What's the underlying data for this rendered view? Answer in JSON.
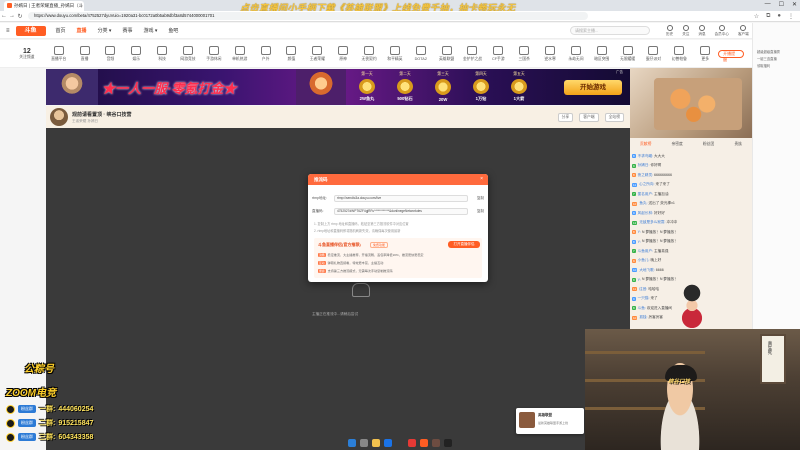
{
  "browser": {
    "tab_title": "孙嫣日 | 王者荣耀直播_孙嫣日（斗",
    "banner_text": "点击直播间小手柄下载《英雄联盟》上线免费千抽，抽卡畅玩永无",
    "url": "https://www.douyu.com/beta/4752527dyuVuio=1920a31-bc0172a0b5ab9dbf3a8d5744000001701"
  },
  "site": {
    "logo": "斗鱼",
    "nav": [
      {
        "label": "首页"
      },
      {
        "label": "直播"
      },
      {
        "label": "分类 ▾"
      },
      {
        "label": "赛事"
      },
      {
        "label": "游戏 ▾"
      },
      {
        "label": "鱼吧"
      }
    ],
    "search_placeholder": "请搜索主播...",
    "header_icons": [
      {
        "label": "历史",
        "icon": "history-icon"
      },
      {
        "label": "关注",
        "icon": "follow-icon"
      },
      {
        "label": "消息",
        "icon": "message-icon"
      },
      {
        "label": "会员中心",
        "icon": "member-icon"
      },
      {
        "label": "客户端",
        "icon": "client-icon"
      }
    ]
  },
  "categories": {
    "count": "12",
    "count_label": "关注频道",
    "items": [
      "直播平台",
      "直播",
      "音频",
      "娱乐",
      "科技",
      "网游竞技",
      "手游休闲",
      "单机热游",
      "户外",
      "颜值",
      "王者荣耀",
      "原神",
      "无畏契约",
      "和平精英",
      "DOTA2",
      "英雄联盟",
      "金铲铲之战",
      "CF手游",
      "三国杀",
      "逆水寒",
      "永劫无间",
      "暗区突围",
      "无限暖暖",
      "蛋仔派对",
      "幻兽帕鲁",
      "更多"
    ],
    "fav_button": "开播提醒"
  },
  "ad": {
    "title": "★一人一服·零氪打金★",
    "coins": [
      {
        "top": "第一天",
        "value": "2W鱼丸"
      },
      {
        "top": "第二天",
        "value": "500钻石"
      },
      {
        "top": "第三天",
        "value": "20W"
      },
      {
        "top": "第四天",
        "value": "1万钻"
      },
      {
        "top": "第五天",
        "value": "1大箭"
      }
    ],
    "button": "开始游戏",
    "mark": "广告"
  },
  "room": {
    "title": "观前请看置顶 · 峡谷口技营",
    "subtitle": "王者荣耀  孙嫣日",
    "actions": [
      "分享",
      "客户端",
      "全站榜"
    ]
  },
  "modal": {
    "title": "推流码",
    "close": "×",
    "rtmp_label": "rtmp地址:",
    "rtmp_value": "rtmp://sendtc3a.douyu.com/live",
    "key_label": "直播码:",
    "key_value": "4752527dWPT6ZF4gjRFu************&dunlinegeNetworkdes",
    "copy": "复制",
    "notes": [
      "1. 复制上方 rtmp 地址和直播码，粘贴至第三方推流软件中对应位置",
      "2. rtmp地址和直播码即将随机刷新失效，请确保每次使用最新"
    ],
    "promo": {
      "title": "斗鱼直播伴侣(官方推荐)",
      "badge": "免费功能",
      "button": "打开直播伴侣",
      "lines": [
        {
          "tag": "流畅",
          "text": "稳定推流，大主播推荐，开播流畅，丢包率降低20%，推流更快更稳定"
        },
        {
          "tag": "互动",
          "text": "弹幕礼物直接看，特效更丰富，主播互动"
        },
        {
          "tag": "便捷",
          "text": "支持第三方推流模式，无需每次手动复制推流码"
        }
      ]
    },
    "hint": "主播正在推流中...请稍后尝试"
  },
  "chat": {
    "tabs": [
      "贡献榜",
      "亲密度",
      "粉丝团",
      "贵族"
    ],
    "messages": [
      {
        "badge": "8",
        "user": "不求鸟瞰:",
        "text": "大大大"
      },
      {
        "badge": "9",
        "user": "孙嫣日:",
        "text": "你好啊"
      },
      {
        "badge": "8",
        "user": "夜之精灵:",
        "text": "666666666"
      },
      {
        "badge": "11",
        "user": "心之所向:",
        "text": "来了来了"
      },
      {
        "badge": "7",
        "user": "匿名用户:",
        "text": "主播加油"
      },
      {
        "badge": "10",
        "user": "鱼丸:",
        "text": "送出了 荧光棒x1"
      },
      {
        "badge": "9",
        "user": "风起长林:",
        "text": "好好好"
      },
      {
        "badge": "12",
        "user": "无敌是多么寂寞:",
        "text": "冲冲冲"
      },
      {
        "badge": "8",
        "user": "Y:",
        "text": "N 萝播放！N 萝播放！"
      },
      {
        "badge": "8",
        "user": "Y:",
        "text": "N 萝播放！N 萝播放！"
      },
      {
        "badge": "7",
        "user": "斗鱼用户:",
        "text": "主播真强"
      },
      {
        "badge": "9",
        "user": "小鱼儿:",
        "text": "晚上好"
      },
      {
        "badge": "10",
        "user": "大地飞歌:",
        "text": "6666"
      },
      {
        "badge": "8",
        "user": "Y:",
        "text": "N 萝播放！N 萝播放！"
      },
      {
        "badge": "11",
        "user": "往昔:",
        "text": "哈哈哈"
      },
      {
        "badge": "9",
        "user": "一只猫:",
        "text": "来了"
      },
      {
        "badge": "8",
        "user": "斗鱼:",
        "text": "欢迎进入直播间"
      },
      {
        "badge": "10",
        "user": "孤独:",
        "text": "厉害厉害"
      }
    ]
  },
  "far_strip": [
    "超级超级直播秀",
    "一键三连直播",
    "领取福利"
  ],
  "overlay": {
    "line1": "公粽号",
    "line2": "ZOOM电竞",
    "qq": [
      {
        "tag": "粉丝群",
        "label": "一群:",
        "num": "444060254"
      },
      {
        "tag": "粉丝群",
        "label": "二群:",
        "num": "915215847"
      },
      {
        "tag": "粉丝群",
        "label": "三群:",
        "num": "604343358"
      }
    ]
  },
  "webcam": {
    "scroll_text": "真生死",
    "caption": "峡谷口技"
  },
  "notification": {
    "title": "英雄联盟",
    "subtitle": "最新英雄联盟手游上线"
  }
}
